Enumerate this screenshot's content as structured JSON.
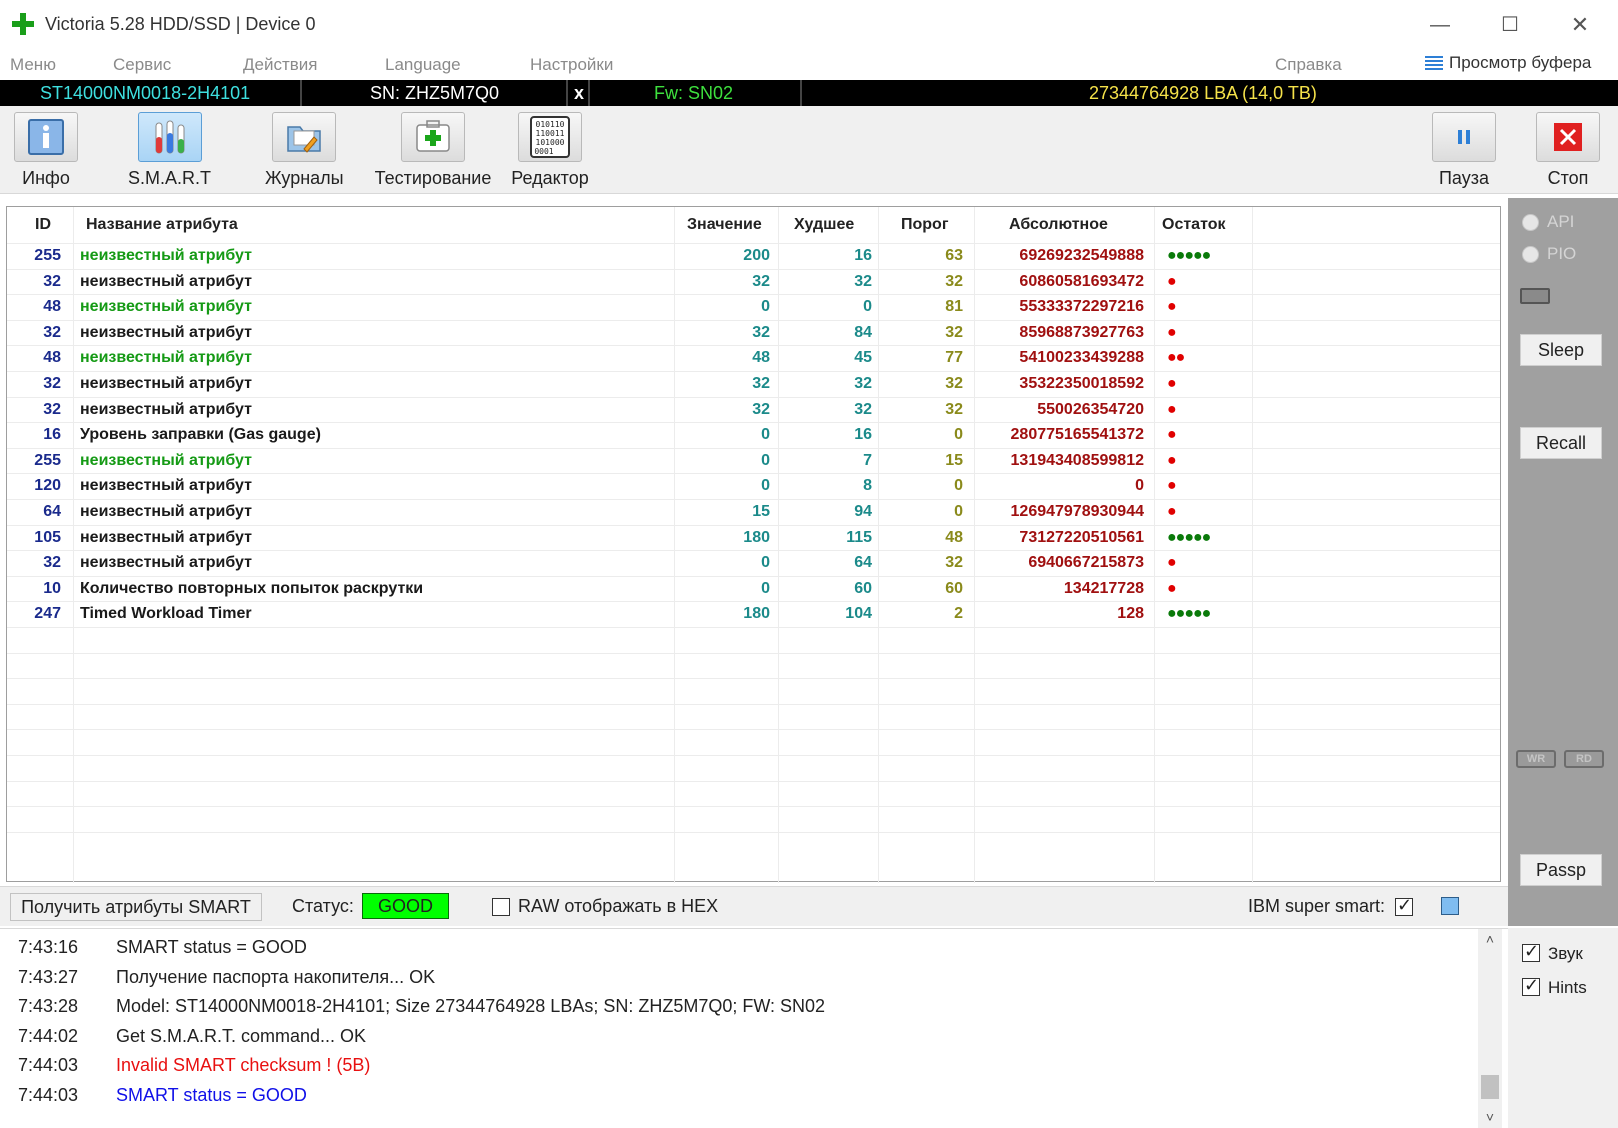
{
  "window": {
    "title": "Victoria 5.28 HDD/SSD | Device 0",
    "minimize": "—",
    "maximize": "☐",
    "close": "✕"
  },
  "menu": {
    "items": [
      "Меню",
      "Сервис",
      "Действия",
      "Language",
      "Настройки",
      "Справка"
    ],
    "buffer_view": "Просмотр буфера"
  },
  "device": {
    "model": "ST14000NM0018-2H4101",
    "serial": "SN: ZHZ5M7Q0",
    "close": "x",
    "firmware": "Fw: SN02",
    "capacity": "27344764928 LBA (14,0 TB)"
  },
  "toolbar": {
    "info": "Инфо",
    "smart": "S.M.A.R.T",
    "logs": "Журналы",
    "testing": "Тестирование",
    "editor": "Редактор",
    "pause": "Пауза",
    "stop": "Стоп",
    "editor_icon_text": "010110\n110011\n101000\n0001"
  },
  "side": {
    "api": "API",
    "pio": "PIO",
    "sleep": "Sleep",
    "recall": "Recall",
    "wr": "WR",
    "rd": "RD",
    "passp": "Passp",
    "sound": "Звук",
    "hints": "Hints"
  },
  "table": {
    "headers": {
      "id": "ID",
      "name": "Название атрибута",
      "value": "Значение",
      "worst": "Худшее",
      "threshold": "Порог",
      "absolute": "Абсолютное",
      "remaining": "Остаток"
    },
    "rows": [
      {
        "id": "255",
        "name": "неизвестный атрибут",
        "name_color": "green",
        "value": "200",
        "worst": "16",
        "threshold": "63",
        "absolute": "69269232549888",
        "remaining": "●●●●●",
        "rem_color": "green"
      },
      {
        "id": "32",
        "name": "неизвестный атрибут",
        "name_color": "black",
        "value": "32",
        "worst": "32",
        "threshold": "32",
        "absolute": "60860581693472",
        "remaining": "●",
        "rem_color": "red"
      },
      {
        "id": "48",
        "name": "неизвестный атрибут",
        "name_color": "green",
        "value": "0",
        "worst": "0",
        "threshold": "81",
        "absolute": "55333372297216",
        "remaining": "●",
        "rem_color": "red"
      },
      {
        "id": "32",
        "name": "неизвестный атрибут",
        "name_color": "black",
        "value": "32",
        "worst": "84",
        "threshold": "32",
        "absolute": "85968873927763",
        "remaining": "●",
        "rem_color": "red"
      },
      {
        "id": "48",
        "name": "неизвестный атрибут",
        "name_color": "green",
        "value": "48",
        "worst": "45",
        "threshold": "77",
        "absolute": "54100233439288",
        "remaining": "●●",
        "rem_color": "red"
      },
      {
        "id": "32",
        "name": "неизвестный атрибут",
        "name_color": "black",
        "value": "32",
        "worst": "32",
        "threshold": "32",
        "absolute": "35322350018592",
        "remaining": "●",
        "rem_color": "red"
      },
      {
        "id": "32",
        "name": "неизвестный атрибут",
        "name_color": "black",
        "value": "32",
        "worst": "32",
        "threshold": "32",
        "absolute": "550026354720",
        "remaining": "●",
        "rem_color": "red"
      },
      {
        "id": "16",
        "name": "Уровень заправки (Gas gauge)",
        "name_color": "black",
        "value": "0",
        "worst": "16",
        "threshold": "0",
        "absolute": "280775165541372",
        "remaining": "●",
        "rem_color": "red"
      },
      {
        "id": "255",
        "name": "неизвестный атрибут",
        "name_color": "green",
        "value": "0",
        "worst": "7",
        "threshold": "15",
        "absolute": "131943408599812",
        "remaining": "●",
        "rem_color": "red"
      },
      {
        "id": "120",
        "name": "неизвестный атрибут",
        "name_color": "black",
        "value": "0",
        "worst": "8",
        "threshold": "0",
        "absolute": "0",
        "remaining": "●",
        "rem_color": "red"
      },
      {
        "id": "64",
        "name": "неизвестный атрибут",
        "name_color": "black",
        "value": "15",
        "worst": "94",
        "threshold": "0",
        "absolute": "126947978930944",
        "remaining": "●",
        "rem_color": "red"
      },
      {
        "id": "105",
        "name": "неизвестный атрибут",
        "name_color": "black",
        "value": "180",
        "worst": "115",
        "threshold": "48",
        "absolute": "73127220510561",
        "remaining": "●●●●●",
        "rem_color": "green"
      },
      {
        "id": "32",
        "name": "неизвестный атрибут",
        "name_color": "black",
        "value": "0",
        "worst": "64",
        "threshold": "32",
        "absolute": "6940667215873",
        "remaining": "●",
        "rem_color": "red"
      },
      {
        "id": "10",
        "name": "Количество повторных попыток раскрутки",
        "name_color": "black",
        "value": "0",
        "worst": "60",
        "threshold": "60",
        "absolute": "134217728",
        "remaining": "●",
        "rem_color": "red"
      },
      {
        "id": "247",
        "name": "Timed Workload Timer",
        "name_color": "black",
        "value": "180",
        "worst": "104",
        "threshold": "2",
        "absolute": "128",
        "remaining": "●●●●●",
        "rem_color": "green"
      }
    ]
  },
  "statusbar": {
    "get_smart": "Получить атрибуты SMART",
    "status_label": "Статус:",
    "status_value": "GOOD",
    "raw_hex": "RAW отображать в HEX",
    "ibm": "IBM super smart:"
  },
  "log": [
    {
      "time": "7:43:16",
      "text": "SMART status = GOOD",
      "color": "black"
    },
    {
      "time": "7:43:27",
      "text": "Получение паспорта накопителя... OK",
      "color": "black"
    },
    {
      "time": "7:43:28",
      "text": "Model: ST14000NM0018-2H4101; Size 27344764928 LBAs; SN: ZHZ5M7Q0; FW: SN02",
      "color": "black"
    },
    {
      "time": "7:44:02",
      "text": "Get S.M.A.R.T. command... OK",
      "color": "black"
    },
    {
      "time": "7:44:03",
      "text": "Invalid SMART checksum ! (5B)",
      "color": "red"
    },
    {
      "time": "7:44:03",
      "text": "SMART status = GOOD",
      "color": "blue"
    }
  ],
  "colors": {
    "status_good": "#00ff00",
    "green_text": "#159a15",
    "dot_red": "#e00000",
    "dot_green": "#0a7a0a"
  }
}
